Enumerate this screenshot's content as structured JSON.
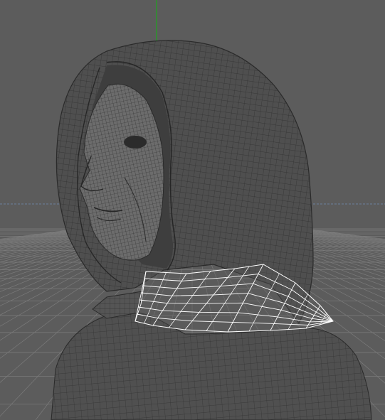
{
  "viewport": {
    "background": "#5c5c5c",
    "grid_color": "#7a7a7a",
    "axis_y_color": "#1fa31f",
    "axis_x_color": "#6b7f9c",
    "mesh_color": "#2e2e2e",
    "selection_color": "#ffffff",
    "model": "hooded-figure-wireframe",
    "selected_part": "collar"
  }
}
